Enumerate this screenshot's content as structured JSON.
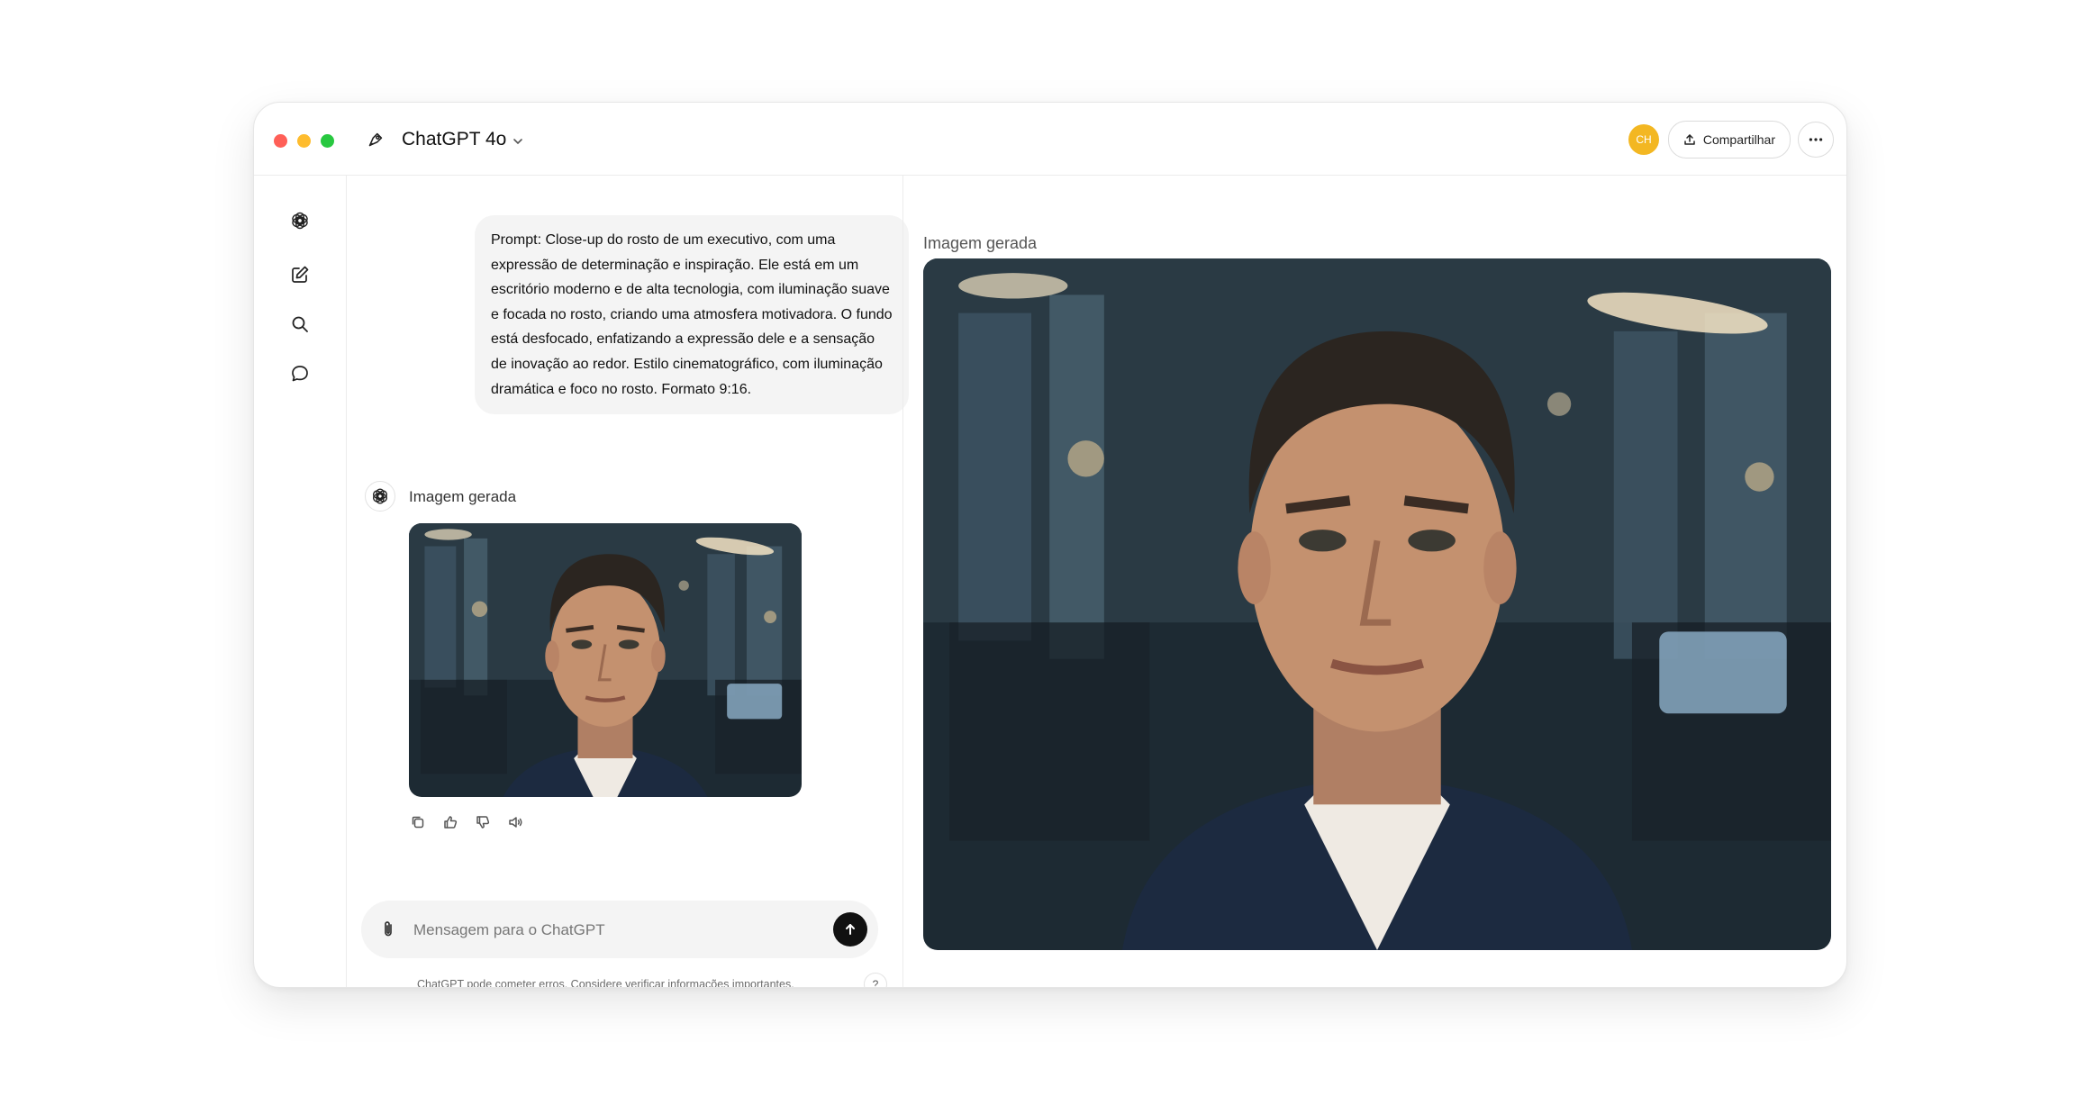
{
  "window": {
    "title": "ChatGPT 4o",
    "avatar_initials": "CH",
    "avatar_color": "#f3b722",
    "share_label": "Compartilhar"
  },
  "sidebar": {
    "items": [
      {
        "icon": "openai-logo-icon"
      },
      {
        "icon": "new-chat-icon"
      },
      {
        "icon": "search-icon"
      },
      {
        "icon": "chat-bubble-icon"
      }
    ]
  },
  "conversation": {
    "user_message": "Prompt:  Close-up do rosto de um executivo, com uma expressão de determinação e inspiração. Ele está em um escritório moderno e de alta tecnologia, com iluminação suave e focada no rosto, criando uma atmosfera motivadora. O fundo está desfocado, enfatizando a expressão dele e a sensação de inovação ao redor. Estilo cinematográfico, com iluminação dramática e foco no rosto. Formato 9:16.",
    "assistant_label": "Imagem gerada",
    "actions": [
      "copy-icon",
      "thumbs-up-icon",
      "thumbs-down-icon",
      "speaker-icon"
    ]
  },
  "composer": {
    "placeholder": "Mensagem para o ChatGPT",
    "disclaimer": "ChatGPT pode cometer erros. Considere verificar informações importantes.",
    "help_label": "?"
  },
  "viewer": {
    "label": "Imagem gerada"
  }
}
